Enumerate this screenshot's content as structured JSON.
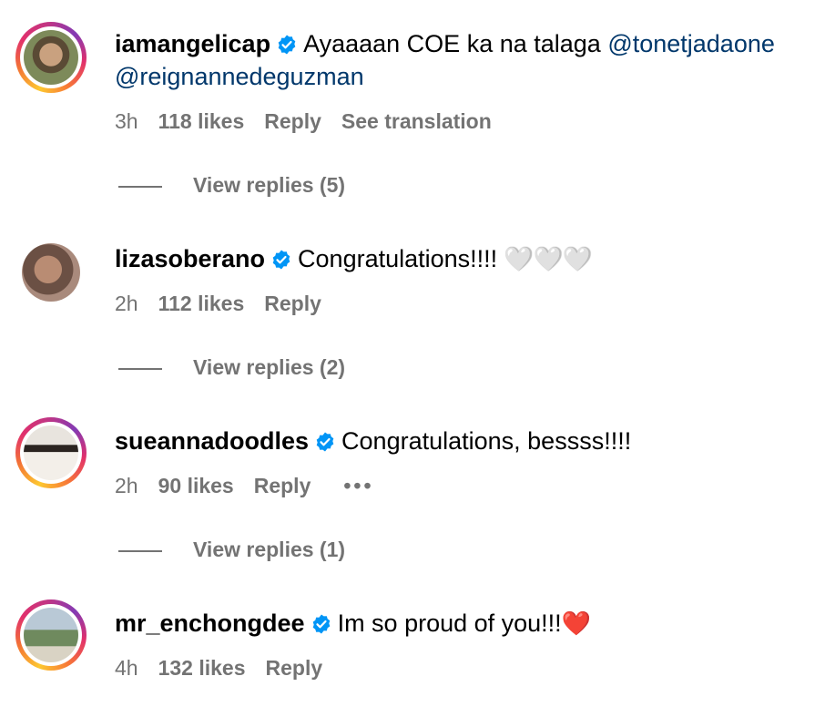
{
  "comments": [
    {
      "username": "iamangelicap",
      "text": "Ayaaaan COE ka na talaga ",
      "mention1": "@tonetjadaone",
      "mention2": "@reignannedeguzman",
      "time": "3h",
      "likes": "118 likes",
      "reply": "Reply",
      "translate": "See translation",
      "replies": "View replies (5)"
    },
    {
      "username": "lizasoberano",
      "text": "Congratulations!!!! ",
      "hearts": "🤍🤍🤍",
      "time": "2h",
      "likes": "112 likes",
      "reply": "Reply",
      "replies": "View replies (2)"
    },
    {
      "username": "sueannadoodles",
      "text": "Congratulations, bessss!!!!",
      "time": "2h",
      "likes": "90 likes",
      "reply": "Reply",
      "more": "•••",
      "replies": "View replies (1)"
    },
    {
      "username": "mr_enchongdee",
      "text": "Im so proud of you!!!",
      "heart": "❤️",
      "time": "4h",
      "likes": "132 likes",
      "reply": "Reply"
    }
  ],
  "colors": {
    "verified": "#0095f6",
    "mention": "#00376b",
    "meta": "#737373"
  }
}
